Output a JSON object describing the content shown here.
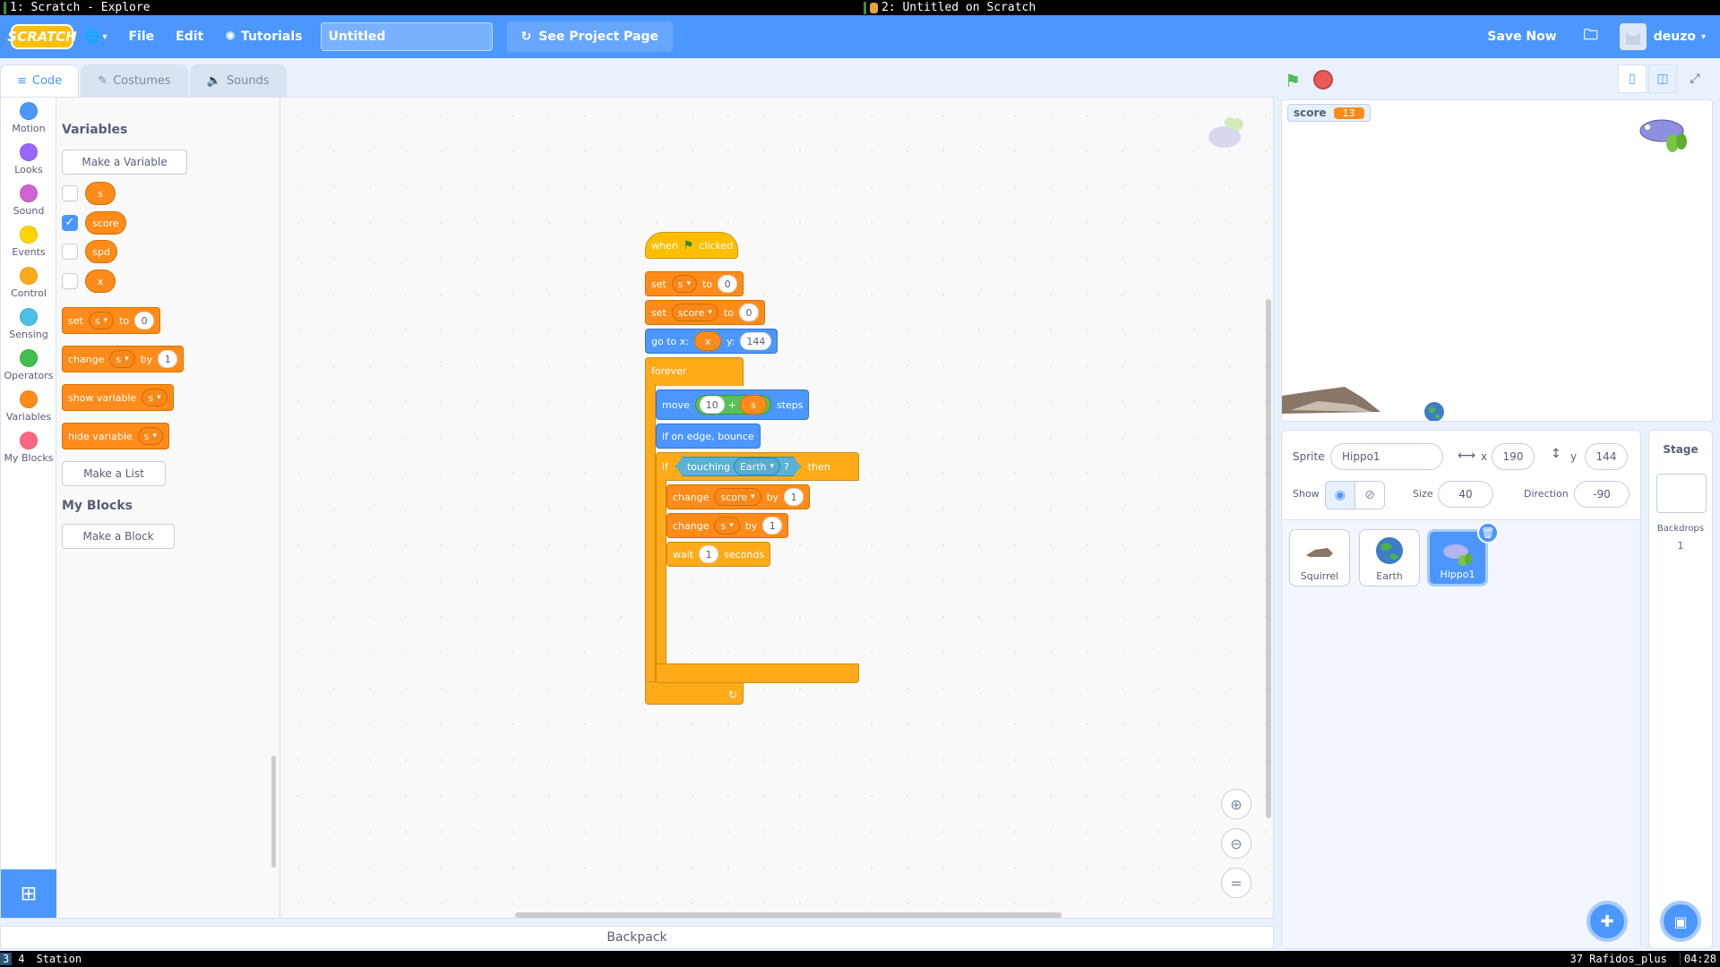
{
  "wm_top": {
    "left_title": "1: Scratch - Explore",
    "right_title": "2: Untitled on Scratch"
  },
  "menubar": {
    "logo": "SCRATCH",
    "file": "File",
    "edit": "Edit",
    "tutorials": "Tutorials",
    "project_title": "Untitled",
    "see_project": "See Project Page",
    "save_now": "Save Now",
    "username": "deuzo"
  },
  "tabs": {
    "code": "Code",
    "costumes": "Costumes",
    "sounds": "Sounds"
  },
  "categories": [
    {
      "label": "Motion",
      "color": "#4c97ff"
    },
    {
      "label": "Looks",
      "color": "#9966ff"
    },
    {
      "label": "Sound",
      "color": "#cf63cf"
    },
    {
      "label": "Events",
      "color": "#ffd500"
    },
    {
      "label": "Control",
      "color": "#ffab19"
    },
    {
      "label": "Sensing",
      "color": "#4cbfe6"
    },
    {
      "label": "Operators",
      "color": "#40bf4a"
    },
    {
      "label": "Variables",
      "color": "#ff8c1a"
    },
    {
      "label": "My Blocks",
      "color": "#ff6680"
    }
  ],
  "flyout": {
    "variables_heading": "Variables",
    "make_variable": "Make a Variable",
    "vars": [
      {
        "name": "s",
        "checked": false
      },
      {
        "name": "score",
        "checked": true
      },
      {
        "name": "spd",
        "checked": false
      },
      {
        "name": "x",
        "checked": false
      }
    ],
    "set_block": {
      "label": "set",
      "var": "s",
      "to": "to",
      "value": "0"
    },
    "change_block": {
      "label": "change",
      "var": "s",
      "by": "by",
      "value": "1"
    },
    "show_block": {
      "label": "show variable",
      "var": "s"
    },
    "hide_block": {
      "label": "hide variable",
      "var": "s"
    },
    "make_list": "Make a List",
    "myblocks_heading": "My Blocks",
    "make_block": "Make a Block"
  },
  "script": {
    "hat": {
      "when": "when",
      "clicked": "clicked"
    },
    "set1": {
      "label": "set",
      "var": "s",
      "to": "to",
      "value": "0"
    },
    "set2": {
      "label": "set",
      "var": "score",
      "to": "to",
      "value": "0"
    },
    "goto": {
      "label": "go to x:",
      "x": "x",
      "ylabel": "y:",
      "y": "144"
    },
    "forever": "forever",
    "move": {
      "label": "move",
      "a": "10",
      "op": "+",
      "b": "s",
      "steps": "steps"
    },
    "bounce": "if on edge, bounce",
    "if": {
      "label": "if",
      "touching": "touching",
      "target": "Earth",
      "q": "?",
      "then": "then"
    },
    "change1": {
      "label": "change",
      "var": "score",
      "by": "by",
      "value": "1"
    },
    "change2": {
      "label": "change",
      "var": "s",
      "by": "by",
      "value": "1"
    },
    "wait": {
      "label": "wait",
      "value": "1",
      "seconds": "seconds"
    }
  },
  "backpack": "Backpack",
  "stage": {
    "monitor_label": "score",
    "monitor_value": "13"
  },
  "sprite_info": {
    "sprite_label": "Sprite",
    "sprite_name": "Hippo1",
    "x_label": "x",
    "x_value": "190",
    "y_label": "y",
    "y_value": "144",
    "show_label": "Show",
    "size_label": "Size",
    "size_value": "40",
    "direction_label": "Direction",
    "direction_value": "-90"
  },
  "sprites": [
    {
      "name": "Squirrel",
      "selected": false
    },
    {
      "name": "Earth",
      "selected": false
    },
    {
      "name": "Hippo1",
      "selected": true
    }
  ],
  "stage_pane": {
    "title": "Stage",
    "backdrops_label": "Backdrops",
    "backdrops_count": "1"
  },
  "wm_bottom": {
    "ws_active": "3",
    "ws_other": "4",
    "station": "Station",
    "status": "37 Rafidos_plus",
    "time": "04:28"
  }
}
